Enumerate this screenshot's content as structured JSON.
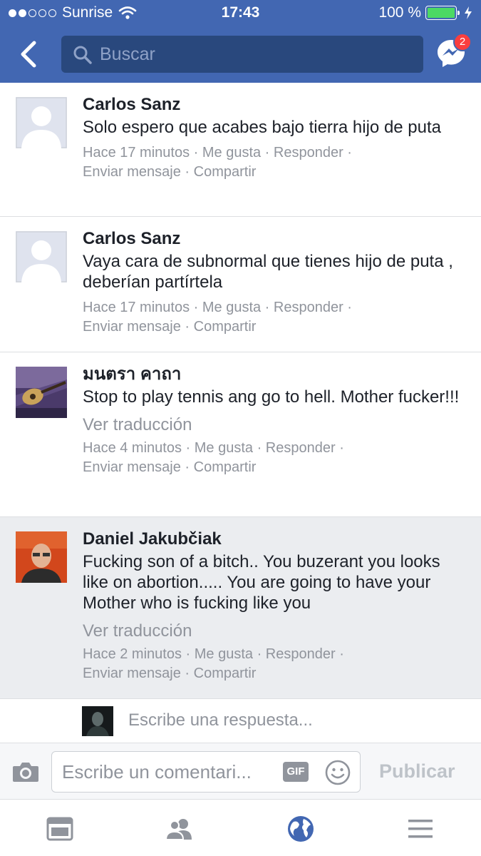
{
  "status": {
    "carrier": "Sunrise",
    "time": "17:43",
    "battery": "100 %"
  },
  "nav": {
    "search_placeholder": "Buscar",
    "messenger_badge": "2"
  },
  "comments": [
    {
      "author": "Carlos Sanz",
      "text": "Solo espero que acabes bajo tierra hijo de puta",
      "time": "Hace 17 minutos",
      "like": "Me gusta",
      "reply": "Responder",
      "message": "Enviar mensaje",
      "share": "Compartir"
    },
    {
      "author": "Carlos Sanz",
      "text": "Vaya cara de subnormal que tienes hijo de puta , deberían partírtela",
      "time": "Hace 17 minutos",
      "like": "Me gusta",
      "reply": "Responder",
      "message": "Enviar mensaje",
      "share": "Compartir"
    },
    {
      "author": "มนตรา คาถา",
      "text": "Stop to play tennis ang go to hell. Mother fucker!!!",
      "translate": "Ver traducción",
      "time": "Hace 4 minutos",
      "like": "Me gusta",
      "reply": "Responder",
      "message": "Enviar mensaje",
      "share": "Compartir"
    },
    {
      "author": "Daniel Jakubčiak",
      "text": "Fucking son of a bitch.. You buzerant you looks like on abortion..... You are going to have your Mother who is fucking like you",
      "translate": "Ver traducción",
      "time": "Hace 2 minutos",
      "like": "Me gusta",
      "reply": "Responder",
      "message": "Enviar mensaje",
      "share": "Compartir"
    }
  ],
  "reply_placeholder": "Escribe una respuesta...",
  "composer": {
    "placeholder": "Escribe un comentari...",
    "gif": "GIF",
    "publish": "Publicar"
  },
  "colors": {
    "brand": "#4267b2",
    "search_bg": "#29487d",
    "meta": "#90949c",
    "highlight": "#ebedf0",
    "badge": "#fa3e3e"
  },
  "icons": [
    "back-icon",
    "search-icon",
    "messenger-icon",
    "camera-icon",
    "smiley-icon",
    "news-feed-icon",
    "friends-icon",
    "globe-icon",
    "menu-icon"
  ]
}
